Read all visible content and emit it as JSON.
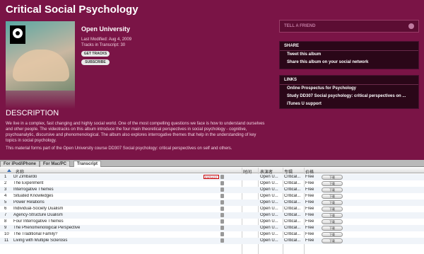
{
  "album": {
    "title": "Critical Social Psychology",
    "author": "Open University",
    "last_modified": "Last Modified: Aug 4, 2009",
    "tracks_info": "Tracks in Transcript: 30",
    "get_tracks_label": "GET TRACKS",
    "subscribe_label": "SUBSCRIBE"
  },
  "description": {
    "heading": "DESCRIPTION",
    "para1": "We live in a complex, fast changing and highly social world. One of the most compelling questions we face is how to understand ourselves and other people. The videotracks on this album introduce the four main theoretical perspectives in social psychology - cognitive, psychoanalytic, discursive and phenomenological. The album also explores interrogative themes that help in the understanding of key topics in social psychology.",
    "para2": "This material forms part of the Open University course DD307 Social psychology: critical perspectives on self and others."
  },
  "sidebar": {
    "tell_a_friend": "TELL A FRIEND",
    "share": {
      "heading": "SHARE",
      "items": [
        "Tweet this album",
        "Share this album on your social network"
      ]
    },
    "links": {
      "heading": "LINKS",
      "items": [
        "Online Prospectus for Psychology",
        "Study DD307 Social psychology: critical perspectives on ...",
        "iTunes U support"
      ]
    }
  },
  "tabs": [
    "For iPod/iPhone",
    "For Mac/PC",
    "Transcript"
  ],
  "table": {
    "headers": [
      "名称",
      "时间",
      "表演者",
      "专辑",
      "价格"
    ],
    "explicit_label": "EXPLICIT",
    "rows": [
      {
        "num": "1",
        "name": "Dr Zimbardo",
        "artist": "Open U...",
        "album": "Critical...",
        "price": "Free",
        "btn": "下载"
      },
      {
        "num": "2",
        "name": "The Experiment",
        "artist": "Open U...",
        "album": "Critical...",
        "price": "Free",
        "btn": "下载"
      },
      {
        "num": "3",
        "name": "Interrogative Themes",
        "artist": "Open U...",
        "album": "Critical...",
        "price": "Free",
        "btn": "下载"
      },
      {
        "num": "4",
        "name": "Situated Knowledges",
        "artist": "Open U...",
        "album": "Critical...",
        "price": "Free",
        "btn": "下载"
      },
      {
        "num": "5",
        "name": "Power Relations",
        "artist": "Open U...",
        "album": "Critical...",
        "price": "Free",
        "btn": "下载"
      },
      {
        "num": "6",
        "name": "Individual-Society Dualism",
        "artist": "Open U...",
        "album": "Critical...",
        "price": "Free",
        "btn": "下载"
      },
      {
        "num": "7",
        "name": "Agency-Structure Dualism",
        "artist": "Open U...",
        "album": "Critical...",
        "price": "Free",
        "btn": "下载"
      },
      {
        "num": "8",
        "name": "Four Interrogative Themes",
        "artist": "Open U...",
        "album": "Critical...",
        "price": "Free",
        "btn": "下载"
      },
      {
        "num": "9",
        "name": "The Phenomenological Perspective",
        "artist": "Open U...",
        "album": "Critical...",
        "price": "Free",
        "btn": "下载"
      },
      {
        "num": "10",
        "name": "The Traditional Family?",
        "artist": "Open U...",
        "album": "Critical...",
        "price": "Free",
        "btn": "下载"
      },
      {
        "num": "11",
        "name": "Living with Multiple Sclerosis",
        "artist": "Open U...",
        "album": "Critical...",
        "price": "Free",
        "btn": "下载"
      }
    ]
  }
}
